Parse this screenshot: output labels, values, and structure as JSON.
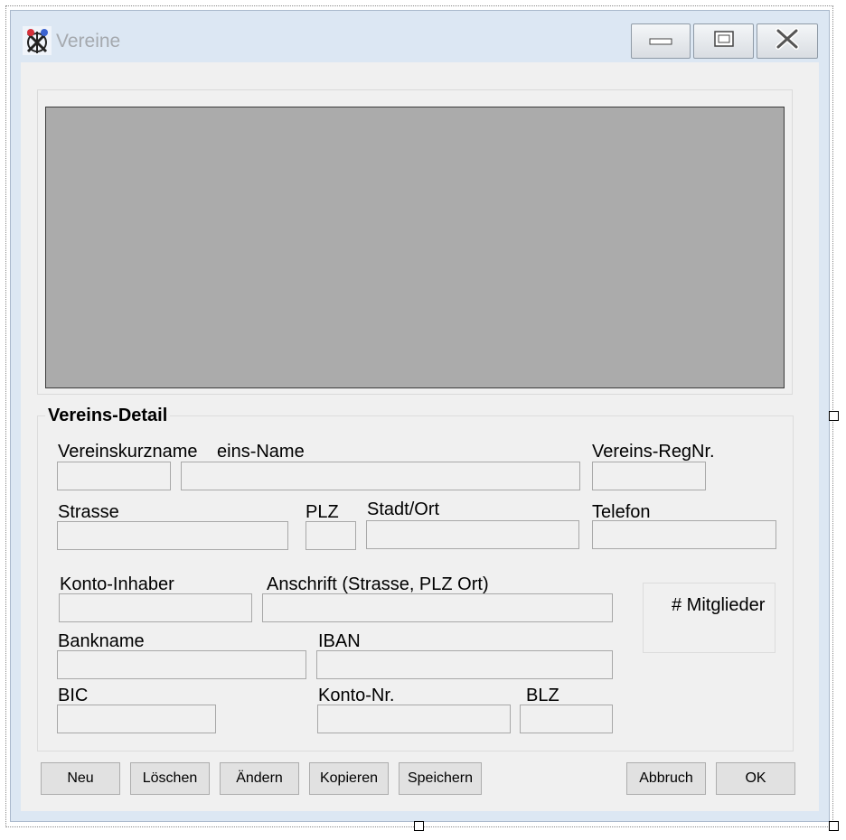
{
  "window": {
    "title": "Vereine"
  },
  "caption_buttons": {
    "minimize": "minimize",
    "maximize": "maximize",
    "close": "close"
  },
  "detail": {
    "group_title": "Vereins-Detail",
    "labels": {
      "kurzname": "Vereinskurzname",
      "name": "eins-Name",
      "regnr": "Vereins-RegNr.",
      "strasse": "Strasse",
      "plz": "PLZ",
      "ort": "Stadt/Ort",
      "telefon": "Telefon",
      "konto_inhaber": "Konto-Inhaber",
      "anschrift": "Anschrift (Strasse, PLZ Ort)",
      "mitglieder": "# Mitglieder",
      "bankname": "Bankname",
      "iban": "IBAN",
      "bic": "BIC",
      "konto_nr": "Konto-Nr.",
      "blz": "BLZ"
    },
    "values": {
      "kurzname": "",
      "name": "",
      "regnr": "",
      "strasse": "",
      "plz": "",
      "ort": "",
      "telefon": "",
      "konto_inhaber": "",
      "anschrift": "",
      "bankname": "",
      "iban": "",
      "bic": "",
      "konto_nr": "",
      "blz": ""
    }
  },
  "buttons": {
    "neu": "Neu",
    "loeschen": "Löschen",
    "aendern": "Ändern",
    "kopieren": "Kopieren",
    "speichern": "Speichern",
    "abbruch": "Abbruch",
    "ok": "OK"
  }
}
